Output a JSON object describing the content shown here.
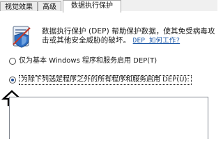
{
  "tabs": [
    {
      "label": "视觉效果",
      "active": false
    },
    {
      "label": "高级",
      "active": false
    },
    {
      "label": "数据执行保护",
      "active": true
    }
  ],
  "description": {
    "text": "数据执行保护 (DEP) 帮助保护数据，使其免受病毒攻击或其他安全威胁的破坏。",
    "link": "DEP 如何工作?"
  },
  "options": [
    {
      "label": "仅为基本 Windows 程序和服务启用 DEP(T)",
      "checked": false
    },
    {
      "label": "为除下列选定程序之外的所有程序和服务启用 DEP(U):",
      "checked": true
    }
  ],
  "icons": {
    "shield": "dep-shield-icon",
    "annotation": "up-arrow-icon"
  },
  "colors": {
    "link": "#1f5aa8",
    "tab_border": "#a9a9a9",
    "radio_selected": "#1f4f9a"
  }
}
